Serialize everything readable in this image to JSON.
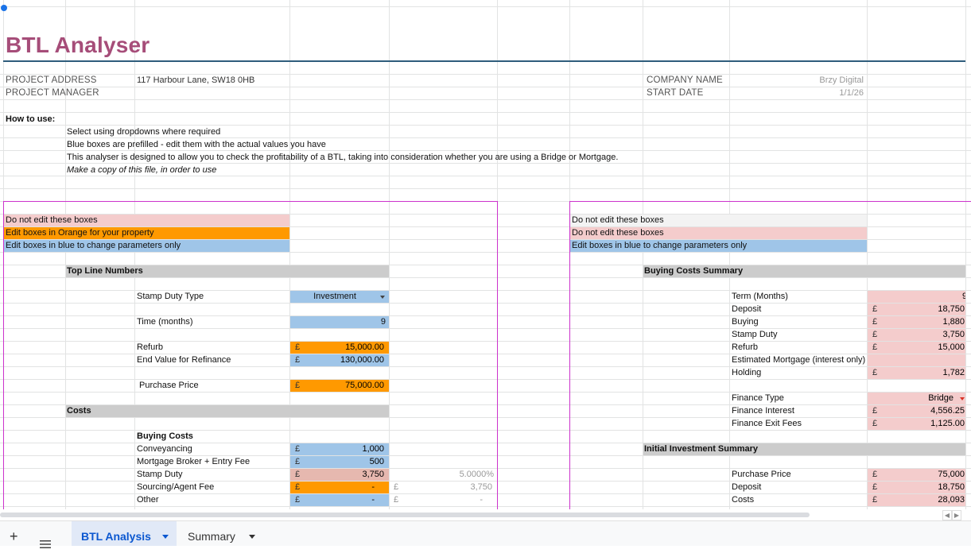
{
  "title": "BTL Analyser",
  "header": {
    "project_address_label": "PROJECT ADDRESS",
    "project_address": "117 Harbour Lane, SW18 0HB",
    "project_manager_label": "PROJECT MANAGER",
    "company_name_label": "COMPANY NAME",
    "company_name": "Brzy Digital",
    "start_date_label": "START DATE",
    "start_date": "1/1/26"
  },
  "how_to_use": {
    "label": "How to use:",
    "lines": [
      "Select using dropdowns where required",
      "Blue boxes are prefilled - edit them with the actual values you have",
      "This analyser is designed to allow you to check the profitability of a BTL, taking into consideration whether you are using a Bridge or Mortgage.",
      "Make a copy of this file, in order to use"
    ]
  },
  "legend_left": [
    "Do not edit these boxes",
    "Edit boxes in Orange for your property",
    "Edit boxes in blue to change parameters only"
  ],
  "legend_right": [
    "Do not edit these boxes",
    "Do not edit these boxes",
    "Edit boxes in blue to change parameters only"
  ],
  "top_line": {
    "heading": "Top Line Numbers",
    "stamp_duty_type_label": "Stamp Duty Type",
    "stamp_duty_type": "Investment",
    "time_label": "Time (months)",
    "time": "9",
    "refurb_label": "Refurb",
    "refurb": "15,000.00",
    "end_value_label": "End Value for Refinance",
    "end_value": "130,000.00",
    "purchase_price_label": "Purchase Price",
    "purchase_price": "75,000.00"
  },
  "costs": {
    "heading": "Costs",
    "buying_costs_label": "Buying Costs",
    "rows": [
      {
        "label": "Conveyancing",
        "value": "1,000"
      },
      {
        "label": "Mortgage Broker + Entry Fee",
        "value": "500"
      },
      {
        "label": "Stamp Duty",
        "value": "3,750",
        "pct": "5.0000%"
      },
      {
        "label": "Sourcing/Agent Fee",
        "value": "-",
        "extra": "3,750"
      },
      {
        "label": "Other",
        "value": "-",
        "extra": "-"
      }
    ]
  },
  "currency": "£",
  "buying_summary": {
    "heading": "Buying Costs Summary",
    "term_label": "Term (Months)",
    "term": "9",
    "rows": [
      {
        "label": "Deposit",
        "value": "18,750"
      },
      {
        "label": "Buying",
        "value": "1,880"
      },
      {
        "label": "Stamp Duty",
        "value": "3,750"
      },
      {
        "label": "Refurb",
        "value": "15,000"
      }
    ],
    "mortgage_label": "Estimated Mortgage (interest only)",
    "holding_label": "Holding",
    "holding": "1,782",
    "finance_type_label": "Finance Type",
    "finance_type": "Bridge",
    "finance_interest_label": "Finance Interest",
    "finance_interest": "4,556.25",
    "finance_exit_label": "Finance Exit Fees",
    "finance_exit": "1,125.00"
  },
  "initial_investment": {
    "heading": "Initial Investment Summary",
    "rows": [
      {
        "label": "Purchase Price",
        "value": "75,000"
      },
      {
        "label": "Deposit",
        "value": "18,750"
      },
      {
        "label": "Costs",
        "value": "28,093"
      }
    ]
  },
  "tabs": {
    "add_label": "+",
    "active": "BTL Analysis",
    "inactive": "Summary"
  }
}
